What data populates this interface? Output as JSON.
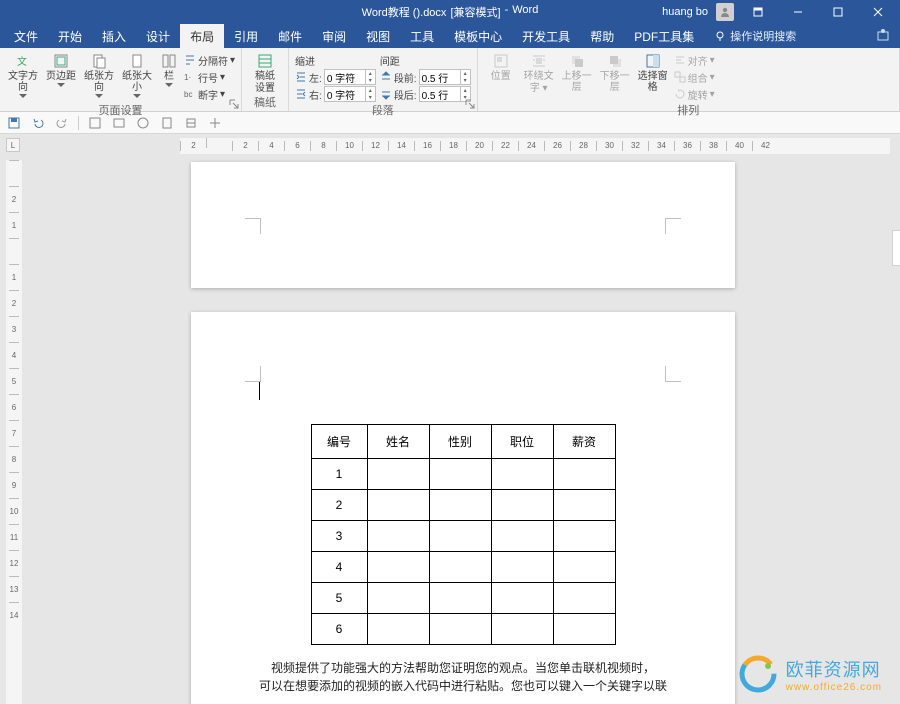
{
  "titlebar": {
    "doc_name": "Word教程 ().docx",
    "mode": "[兼容模式]",
    "app": "Word",
    "user": "huang bo"
  },
  "tabs": {
    "file": "文件",
    "home": "开始",
    "insert": "插入",
    "design": "设计",
    "layout": "布局",
    "references": "引用",
    "mailings": "邮件",
    "review": "审阅",
    "view": "视图",
    "tools": "工具",
    "template": "模板中心",
    "developer": "开发工具",
    "help": "帮助",
    "pdf": "PDF工具集",
    "tell_me": "操作说明搜索"
  },
  "ribbon": {
    "page_setup": {
      "text_direction": "文字方向",
      "margins": "页边距",
      "orientation": "纸张方向",
      "size": "纸张大小",
      "columns": "栏",
      "breaks": "分隔符",
      "line_numbers": "行号",
      "hyphenation": "断字",
      "label": "页面设置"
    },
    "gaozhi": {
      "settings": "稿纸",
      "settings2": "设置",
      "label": "稿纸"
    },
    "paragraph": {
      "indent_label": "缩进",
      "spacing_label": "间距",
      "left": "左:",
      "right": "右:",
      "before": "段前:",
      "after": "段后:",
      "left_val": "0 字符",
      "right_val": "0 字符",
      "before_val": "0.5 行",
      "after_val": "0.5 行",
      "label": "段落"
    },
    "arrange": {
      "position": "位置",
      "wrap": "环绕文",
      "forward": "上移一层",
      "backward": "下移一层",
      "selection_pane": "选择窗格",
      "align": "对齐",
      "group": "组合",
      "rotate": "旋转",
      "label": "排列"
    }
  },
  "ruler_marker": "L",
  "table": {
    "headers": [
      "编号",
      "姓名",
      "性别",
      "职位",
      "薪资"
    ],
    "rows": [
      "1",
      "2",
      "3",
      "4",
      "5",
      "6"
    ]
  },
  "body_text_1": "视频提供了功能强大的方法帮助您证明您的观点。当您单击联机视频时，",
  "body_text_2": "可以在想要添加的视频的嵌入代码中进行粘贴。您也可以键入一个关键字以联",
  "watermark": {
    "brand": "欧菲资源网",
    "url": "www.office26.com"
  }
}
